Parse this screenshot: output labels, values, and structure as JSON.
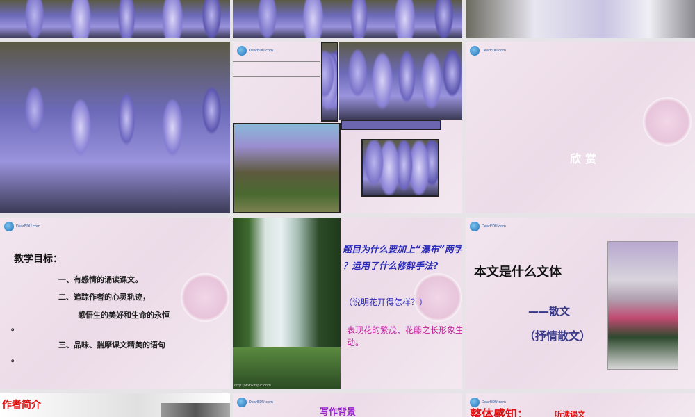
{
  "slides": [
    {
      "id": 1,
      "type": "image",
      "alt": "wisteria"
    },
    {
      "id": 2,
      "type": "image",
      "alt": "wisteria"
    },
    {
      "id": 3,
      "type": "image",
      "alt": "wisteria white"
    },
    {
      "id": 4,
      "type": "image",
      "alt": "wisteria closeup"
    },
    {
      "id": 5,
      "type": "collage"
    },
    {
      "id": 6,
      "title": "欣赏"
    },
    {
      "id": 7,
      "title": "教学目标：",
      "items": [
        "一、有感情的诵读课文。",
        "二、追踪作者的心灵轨迹，",
        "感悟生的美好和生命的永恒",
        "。",
        "三、品味、揣摩课文精美的语句",
        "。"
      ]
    },
    {
      "id": 8,
      "question": "题目为什么要加上“瀑布”两字 ？运用了什么修辞手法?",
      "sub": "（说明花开得怎样？）",
      "answer": "表现花的繁茂、花藤之长形象生动。",
      "watermark": "http://www.nipic.com"
    },
    {
      "id": 9,
      "title": "本文是什么文体",
      "answer1": "——散文",
      "answer2": "（抒情散文）"
    },
    {
      "id": 10,
      "title": "作者简介"
    },
    {
      "id": 11,
      "title": "写作背景"
    },
    {
      "id": 12,
      "title": "整体感知：",
      "sub": "听读课文"
    }
  ],
  "logo_text": "DearEDU.com",
  "colors": {
    "blue": "#2a2ab8",
    "magenta": "#c0209a",
    "red": "#e01010",
    "purple": "#9a20d0",
    "navy": "#3a3a8a"
  }
}
